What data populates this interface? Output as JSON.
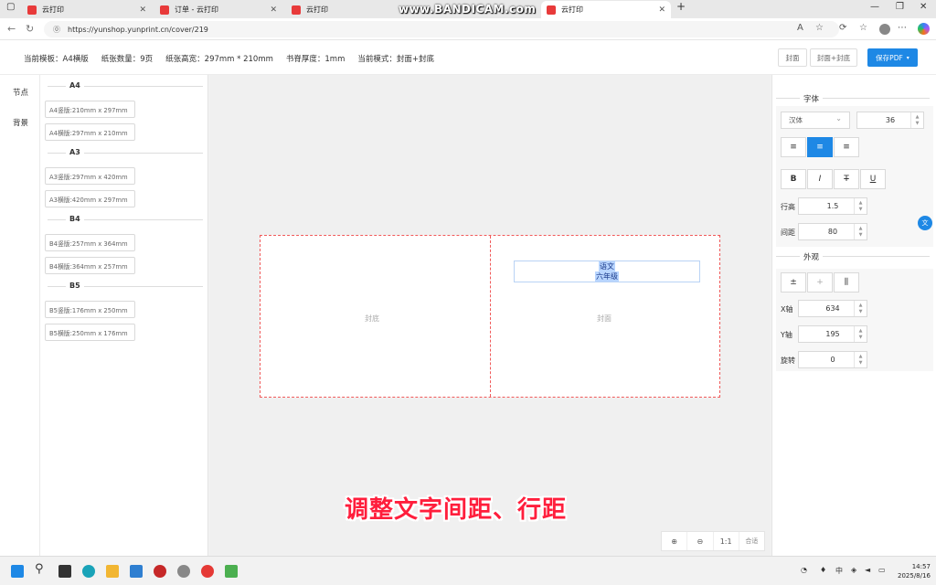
{
  "browser": {
    "tabs": [
      {
        "title": "云打印",
        "active": false
      },
      {
        "title": "订单 - 云打印",
        "active": false
      },
      {
        "title": "云打印",
        "active": false
      },
      {
        "title": "云打印",
        "active": true
      }
    ],
    "watermark": "www.BANDICAM.com",
    "url": "https://yunshop.yunprint.cn/cover/219"
  },
  "info": {
    "template": "当前模板：A4横版",
    "paper_count": "纸张数量：9页",
    "paper_size": "纸张高宽：297mm * 210mm",
    "spine": "书脊厚度：1mm",
    "mode": "当前模式：封面+封底"
  },
  "top_buttons": {
    "cover": "封面",
    "cover_back": "封面+封底",
    "save_pdf": "保存PDF"
  },
  "left_nav": [
    "节点",
    "背景"
  ],
  "template_groups": [
    {
      "name": "A4",
      "items": [
        "A4竖版:210mm x 297mm",
        "A4横版:297mm x 210mm"
      ]
    },
    {
      "name": "A3",
      "items": [
        "A3竖版:297mm x 420mm",
        "A3横版:420mm x 297mm"
      ]
    },
    {
      "name": "B4",
      "items": [
        "B4竖版:257mm x 364mm",
        "B4横版:364mm x 257mm"
      ]
    },
    {
      "name": "B5",
      "items": [
        "B5竖版:176mm x 250mm",
        "B5横版:250mm x 176mm"
      ]
    }
  ],
  "canvas": {
    "back_label": "封底",
    "front_label": "封面",
    "text_lines": [
      "语文",
      "六年级"
    ],
    "subtitle": "调整文字间距、行距",
    "zoom": {
      "zoom_in": "⊕",
      "zoom_out": "⊖",
      "ratio": "1:1",
      "fit": "合适"
    }
  },
  "font_panel": {
    "section": "字体",
    "font_family": "汉体",
    "font_size": "36",
    "line_height_label": "行高",
    "line_height": "1.5",
    "spacing_label": "间距",
    "spacing": "80"
  },
  "look_panel": {
    "section": "外观",
    "x_label": "X轴",
    "x_value": "634",
    "y_label": "Y轴",
    "y_value": "195",
    "rotate_label": "旋转",
    "rotate_value": "0"
  },
  "taskbar": {
    "time": "14:57",
    "date": "2025/8/16",
    "ime": "中"
  },
  "colors": {
    "accent": "#1e88e5",
    "border_dash": "#f05a5a",
    "subtitle": "#ff1e3c"
  }
}
